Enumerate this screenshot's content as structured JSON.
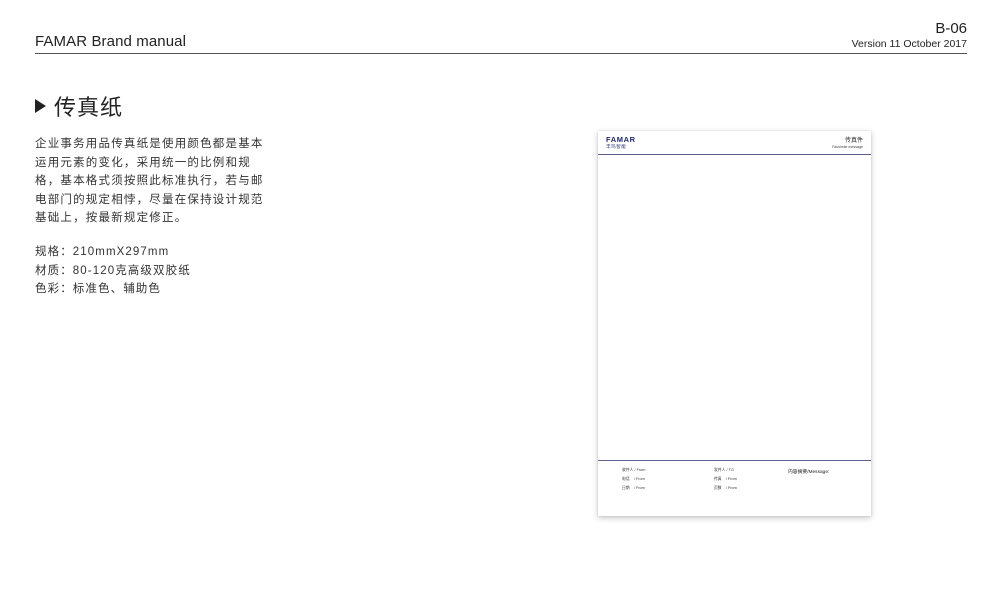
{
  "header": {
    "brand": "FAMAR Brand manual",
    "page_code": "B-06",
    "version": "Version 11  October  2017"
  },
  "section": {
    "title": "传真纸",
    "description": "企业事务用品传真纸是使用颜色都是基本运用元素的变化，采用统一的比例和规格，基本格式须按照此标准执行，若与邮电部门的规定相悖，尽量在保持设计规范基础上，按最新规定修正。",
    "specs": [
      "规格：210mmX297mm",
      "材质：80-120克高级双胶纸",
      "色彩：标准色、辅助色"
    ]
  },
  "fax_sheet": {
    "logo_en": "FAMAR",
    "logo_cn": "丰玛智能",
    "title_cn": "传真件",
    "title_en": "Facsimile  message",
    "fields_left": [
      {
        "label": "收件人",
        "suffix": "/ From"
      },
      {
        "label": "电话",
        "suffix": "/ From"
      },
      {
        "label": "日期",
        "suffix": "/ From"
      }
    ],
    "fields_right": [
      {
        "label": "发件人",
        "suffix": "/ TO"
      },
      {
        "label": "传真",
        "suffix": "/ From"
      },
      {
        "label": "页数",
        "suffix": "/ From"
      }
    ],
    "message_label": "内容摘要/Message:"
  },
  "colors": {
    "brand_navy": "#1f2a6b",
    "rule": "#5a5f8c",
    "text": "#222222"
  }
}
